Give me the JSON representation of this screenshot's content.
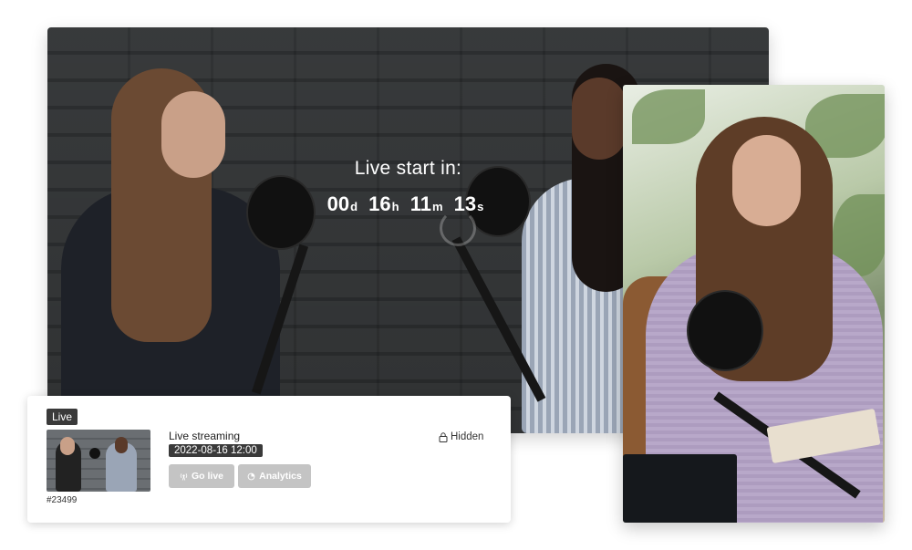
{
  "live_video": {
    "countdown_title": "Live start in:",
    "countdown": [
      {
        "value": "00",
        "unit": "d"
      },
      {
        "value": "16",
        "unit": "h"
      },
      {
        "value": "11",
        "unit": "m"
      },
      {
        "value": "13",
        "unit": "s"
      }
    ]
  },
  "stream_card": {
    "badge": "Live",
    "title": "Live streaming",
    "date": "2022-08-16 12:00",
    "go_live_label": "Go live",
    "analytics_label": "Analytics",
    "visibility": "Hidden",
    "stream_id": "#23499"
  }
}
